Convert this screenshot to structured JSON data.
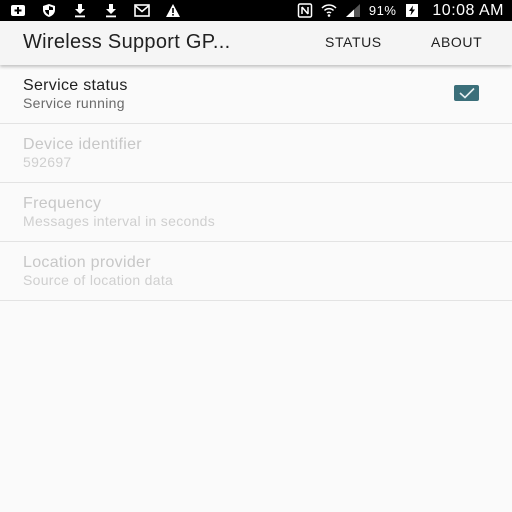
{
  "status_bar": {
    "left_icons": [
      "add-box-icon",
      "shield-icon",
      "download-icon",
      "download-icon",
      "mail-icon",
      "warning-icon"
    ],
    "right_icons": [
      "nfc-icon",
      "wifi-icon",
      "signal-icon"
    ],
    "battery": "91%",
    "time": "10:08 AM"
  },
  "app_bar": {
    "title": "Wireless Support GP...",
    "actions": [
      "STATUS",
      "ABOUT"
    ]
  },
  "preferences": [
    {
      "title": "Service status",
      "summary": "Service running",
      "enabled": true,
      "checked": true
    },
    {
      "title": "Device identifier",
      "summary": "592697",
      "enabled": false
    },
    {
      "title": "Frequency",
      "summary": "Messages interval in seconds",
      "enabled": false
    },
    {
      "title": "Location provider",
      "summary": "Source of location data",
      "enabled": false
    }
  ],
  "colors": {
    "accent": "#3b6f7a",
    "status_bar_bg": "#000000",
    "app_bar_bg": "#f5f5f5",
    "background": "#fafafa"
  }
}
